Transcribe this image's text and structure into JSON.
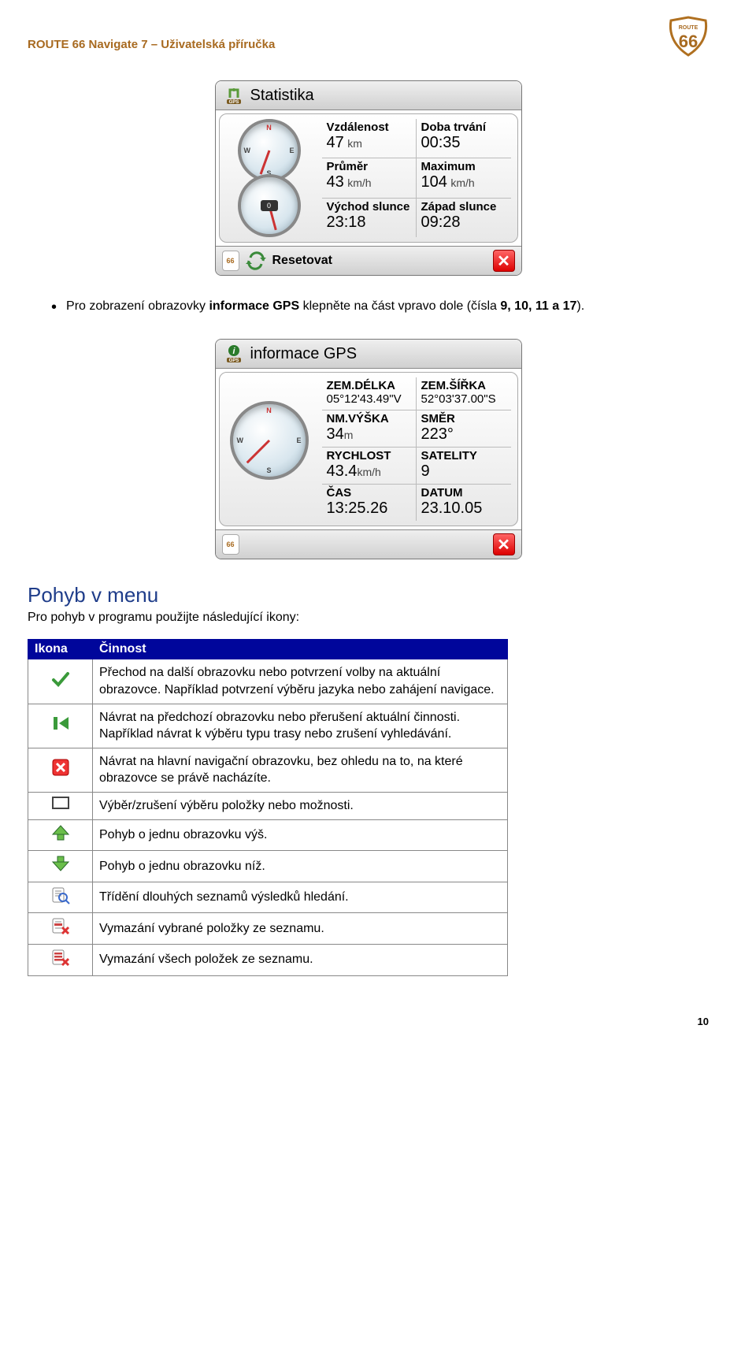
{
  "header": {
    "title": "ROUTE 66 Navigate 7 – Uživatelská příručka",
    "badge": "ROUTE 66"
  },
  "stat_screen": {
    "title": "Statistika",
    "rows": [
      {
        "label": "Vzdálenost",
        "value": "47",
        "unit": "km"
      },
      {
        "label": "Doba trvání",
        "value": "00:35",
        "unit": ""
      },
      {
        "label": "Průměr",
        "value": "43",
        "unit": "km/h"
      },
      {
        "label": "Maximum",
        "value": "104",
        "unit": "km/h"
      },
      {
        "label": "Východ slunce",
        "value": "23:18",
        "unit": ""
      },
      {
        "label": "Západ slunce",
        "value": "09:28",
        "unit": ""
      }
    ],
    "footer_action": "Resetovat"
  },
  "bullet1_pre": "Pro zobrazení obrazovky ",
  "bullet1_bold1": "informace GPS",
  "bullet1_mid": " klepněte na část vpravo dole (čísla ",
  "bullet1_bold2": "9, 10, 11 a 17",
  "bullet1_post": ").",
  "gps_screen": {
    "title": "informace GPS",
    "rows": [
      {
        "label": "ZEM.DÉLKA",
        "value": "05°12'43.49\"V"
      },
      {
        "label": "ZEM.ŠÍŘKA",
        "value": "52°03'37.00\"S"
      },
      {
        "label": "NM.VÝŠKA",
        "value": "34",
        "unit": "m"
      },
      {
        "label": "SMĚR",
        "value": "223°"
      },
      {
        "label": "RYCHLOST",
        "value": "43.4",
        "unit": "km/h"
      },
      {
        "label": "SATELITY",
        "value": "9"
      },
      {
        "label": "ČAS",
        "value": "13:25.26"
      },
      {
        "label": "DATUM",
        "value": "23.10.05"
      }
    ]
  },
  "section": {
    "heading": "Pohyb v menu",
    "intro": "Pro pohyb v programu použijte následující ikony:"
  },
  "table": {
    "col_icon": "Ikona",
    "col_action": "Činnost",
    "rows": [
      "Přechod na další obrazovku nebo potvrzení volby na aktuální obrazovce. Například potvrzení výběru jazyka nebo zahájení navigace.",
      "Návrat na předchozí obrazovku nebo přerušení aktuální činnosti. Například návrat k výběru typu trasy nebo zrušení vyhledávání.",
      "Návrat na hlavní navigační obrazovku, bez ohledu na to, na které obrazovce se právě nacházíte.",
      "Výběr/zrušení výběru položky nebo možnosti.",
      "Pohyb o jednu obrazovku výš.",
      "Pohyb o jednu obrazovku níž.",
      "Třídění dlouhých seznamů výsledků hledání.",
      "Vymazání vybrané položky ze seznamu.",
      "Vymazání všech položek ze seznamu."
    ]
  },
  "page_number": "10"
}
